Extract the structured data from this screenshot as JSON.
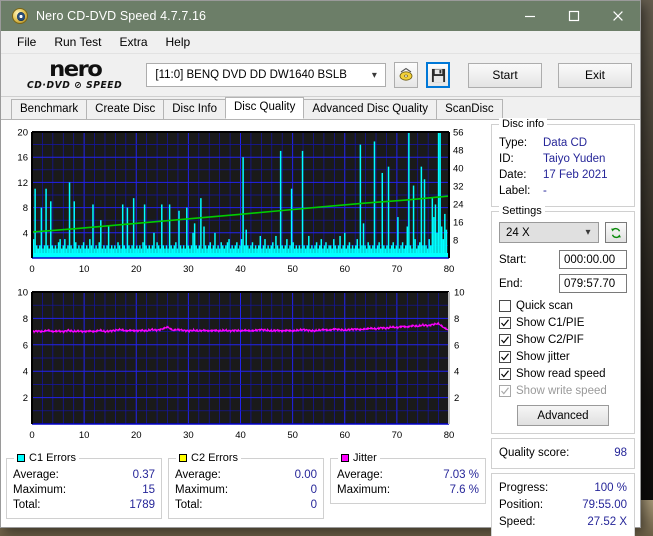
{
  "window": {
    "title": "Nero CD-DVD Speed 4.7.7.16",
    "icon": "nero-app-icon",
    "minimize_icon": "minimize-icon",
    "maximize_icon": "maximize-icon",
    "close_icon": "close-icon"
  },
  "menu": {
    "items": [
      "File",
      "Run Test",
      "Extra",
      "Help"
    ]
  },
  "toolbar": {
    "logo_main": "nero",
    "logo_sub": "CD·DVD ⊘ SPEED",
    "drive": "[11:0]   BENQ DVD DD DW1640 BSLB",
    "drive_chevron": "chevron-down-icon",
    "eject_icon": "eject-disc-icon",
    "save_icon": "save-floppy-icon",
    "start_label": "Start",
    "exit_label": "Exit"
  },
  "tabs": [
    {
      "label": "Benchmark",
      "active": false
    },
    {
      "label": "Create Disc",
      "active": false
    },
    {
      "label": "Disc Info",
      "active": false
    },
    {
      "label": "Disc Quality",
      "active": true
    },
    {
      "label": "Advanced Disc Quality",
      "active": false
    },
    {
      "label": "ScanDisc",
      "active": false
    }
  ],
  "disc_info": {
    "title": "Disc info",
    "rows": [
      {
        "key": "Type:",
        "value": "Data CD"
      },
      {
        "key": "ID:",
        "value": "Taiyo Yuden"
      },
      {
        "key": "Date:",
        "value": "17 Feb 2021"
      },
      {
        "key": "Label:",
        "value": "-"
      }
    ]
  },
  "settings": {
    "title": "Settings",
    "speed": "24 X",
    "speed_chevron": "chevron-down-icon",
    "refresh_icon": "refresh-icon",
    "start_label": "Start:",
    "start_value": "000:00.00",
    "end_label": "End:",
    "end_value": "079:57.70",
    "checkboxes": [
      {
        "label": "Quick scan",
        "checked": false,
        "disabled": false
      },
      {
        "label": "Show C1/PIE",
        "checked": true,
        "disabled": false
      },
      {
        "label": "Show C2/PIF",
        "checked": true,
        "disabled": false
      },
      {
        "label": "Show jitter",
        "checked": true,
        "disabled": false
      },
      {
        "label": "Show read speed",
        "checked": true,
        "disabled": false
      },
      {
        "label": "Show write speed",
        "checked": true,
        "disabled": true
      }
    ],
    "advanced_label": "Advanced"
  },
  "quality": {
    "label": "Quality score:",
    "value": "98"
  },
  "progress": {
    "rows": [
      {
        "key": "Progress:",
        "value": "100 %"
      },
      {
        "key": "Position:",
        "value": "79:55.00"
      },
      {
        "key": "Speed:",
        "value": "27.52 X"
      }
    ]
  },
  "stats": {
    "c1": {
      "title": "C1 Errors",
      "color": "#00ffff",
      "rows": [
        {
          "key": "Average:",
          "value": "0.37"
        },
        {
          "key": "Maximum:",
          "value": "15"
        },
        {
          "key": "Total:",
          "value": "1789"
        }
      ]
    },
    "c2": {
      "title": "C2 Errors",
      "color": "#ffff00",
      "rows": [
        {
          "key": "Average:",
          "value": "0.00"
        },
        {
          "key": "Maximum:",
          "value": "0"
        },
        {
          "key": "Total:",
          "value": "0"
        }
      ]
    },
    "jitter": {
      "title": "Jitter",
      "color": "#ff00ff",
      "rows": [
        {
          "key": "Average:",
          "value": "7.03 %"
        },
        {
          "key": "Maximum:",
          "value": "7.6 %"
        }
      ]
    }
  },
  "chart_data": [
    {
      "type": "bar",
      "name": "c1-errors-chart",
      "title": "",
      "xlabel": "",
      "ylabel": "C1 errors",
      "y2label": "Read speed (X)",
      "xlim": [
        0,
        80
      ],
      "ylim": [
        0,
        20
      ],
      "y2lim": [
        0,
        56
      ],
      "xticks": [
        0,
        10,
        20,
        30,
        40,
        50,
        60,
        70,
        80
      ],
      "yticks": [
        4,
        8,
        12,
        16,
        20
      ],
      "y2ticks": [
        8,
        16,
        24,
        32,
        40,
        48,
        56
      ],
      "grid": true,
      "background": "#1a1a1a",
      "grid_color": "#0000cc",
      "bar_color": "#00ffff",
      "line_color": "#00cc00",
      "x": [
        0.3,
        0.6,
        0.9,
        1.2,
        1.5,
        1.8,
        2.1,
        2.4,
        2.7,
        3.0,
        3.3,
        3.6,
        3.9,
        4.2,
        4.5,
        4.8,
        5.1,
        5.4,
        5.7,
        6.0,
        6.3,
        6.6,
        6.9,
        7.2,
        7.5,
        7.8,
        8.1,
        8.4,
        8.7,
        9.0,
        9.3,
        9.6,
        9.9,
        10.2,
        10.5,
        10.8,
        11.1,
        11.4,
        11.7,
        12.0,
        12.3,
        12.6,
        12.9,
        13.2,
        13.5,
        13.8,
        14.1,
        14.4,
        14.7,
        15.0,
        15.3,
        15.6,
        15.9,
        16.2,
        16.5,
        16.8,
        17.1,
        17.4,
        17.7,
        18.0,
        18.3,
        18.6,
        18.9,
        19.2,
        19.5,
        19.8,
        20.1,
        20.4,
        20.7,
        21.0,
        21.3,
        21.6,
        21.9,
        22.2,
        22.5,
        22.8,
        23.1,
        23.4,
        23.7,
        24.0,
        24.3,
        24.6,
        24.9,
        25.2,
        25.5,
        25.8,
        26.1,
        26.4,
        26.7,
        27.0,
        27.3,
        27.6,
        27.9,
        28.2,
        28.5,
        28.8,
        29.1,
        29.4,
        29.7,
        30.0,
        30.3,
        30.6,
        30.9,
        31.2,
        31.5,
        31.8,
        32.1,
        32.4,
        32.7,
        33.0,
        33.3,
        33.6,
        33.9,
        34.2,
        34.5,
        34.8,
        35.1,
        35.4,
        35.7,
        36.0,
        36.3,
        36.6,
        36.9,
        37.2,
        37.5,
        37.8,
        38.1,
        38.4,
        38.7,
        39.0,
        39.3,
        39.6,
        39.9,
        40.2,
        40.5,
        40.8,
        41.1,
        41.4,
        41.7,
        42.0,
        42.3,
        42.6,
        42.9,
        43.2,
        43.5,
        43.8,
        44.1,
        44.4,
        44.7,
        45.0,
        45.3,
        45.6,
        45.9,
        46.2,
        46.5,
        46.8,
        47.1,
        47.4,
        47.7,
        48.0,
        48.3,
        48.6,
        48.9,
        49.2,
        49.5,
        49.8,
        50.1,
        50.4,
        50.7,
        51.0,
        51.3,
        51.6,
        51.9,
        52.2,
        52.5,
        52.8,
        53.1,
        53.4,
        53.7,
        54.0,
        54.3,
        54.6,
        54.9,
        55.2,
        55.5,
        55.8,
        56.1,
        56.4,
        56.7,
        57.0,
        57.3,
        57.6,
        57.9,
        58.2,
        58.5,
        58.8,
        59.1,
        59.4,
        59.7,
        60.0,
        60.3,
        60.6,
        60.9,
        61.2,
        61.5,
        61.8,
        62.1,
        62.4,
        62.7,
        63.0,
        63.3,
        63.6,
        63.9,
        64.2,
        64.5,
        64.8,
        65.1,
        65.4,
        65.7,
        66.0,
        66.3,
        66.6,
        66.9,
        67.2,
        67.5,
        67.8,
        68.1,
        68.4,
        68.7,
        69.0,
        69.3,
        69.6,
        69.9,
        70.2,
        70.5,
        70.8,
        71.1,
        71.4,
        71.7,
        72.0,
        72.3,
        72.6,
        72.9,
        73.2,
        73.5,
        73.8,
        74.1,
        74.4,
        74.7,
        75.0,
        75.3,
        75.6,
        75.9,
        76.2,
        76.5,
        76.8,
        77.1,
        77.4,
        77.7,
        78.0,
        78.3,
        78.6,
        78.9,
        79.2,
        79.5
      ],
      "values": [
        3.0,
        11.0,
        2.0,
        1.5,
        2.0,
        8.0,
        1.5,
        2.0,
        11.0,
        2.0,
        1.5,
        9.0,
        2.0,
        1.5,
        2.0,
        1.5,
        2.5,
        3.0,
        1.5,
        2.0,
        3.0,
        1.5,
        2.0,
        12.0,
        2.0,
        1.5,
        9.0,
        2.5,
        1.5,
        2.0,
        1.5,
        2.0,
        2.5,
        1.5,
        2.0,
        1.5,
        3.0,
        2.0,
        8.5,
        1.5,
        2.0,
        1.5,
        2.5,
        6.0,
        1.5,
        2.0,
        1.5,
        2.0,
        5.0,
        1.5,
        2.0,
        1.5,
        2.0,
        1.5,
        2.5,
        2.0,
        1.5,
        8.5,
        2.0,
        1.5,
        8.0,
        2.0,
        1.5,
        2.0,
        9.5,
        1.5,
        2.0,
        1.5,
        2.0,
        1.5,
        2.5,
        8.5,
        2.0,
        1.5,
        2.0,
        1.5,
        2.0,
        4.0,
        1.5,
        2.5,
        2.0,
        1.5,
        8.5,
        2.0,
        1.5,
        2.0,
        1.5,
        8.5,
        2.0,
        1.5,
        2.0,
        2.5,
        1.5,
        7.5,
        2.0,
        1.5,
        2.0,
        1.5,
        8.0,
        2.0,
        1.5,
        2.0,
        4.0,
        5.5,
        2.0,
        1.5,
        2.0,
        9.5,
        1.5,
        5.0,
        2.0,
        1.5,
        2.0,
        2.5,
        1.5,
        2.0,
        4.0,
        1.5,
        2.0,
        1.5,
        2.5,
        2.0,
        1.5,
        2.0,
        2.5,
        3.0,
        1.5,
        2.0,
        1.5,
        2.0,
        2.5,
        1.5,
        2.0,
        3.0,
        16.0,
        2.0,
        4.5,
        2.0,
        1.5,
        2.0,
        2.5,
        1.5,
        2.0,
        1.5,
        2.0,
        3.5,
        1.5,
        2.0,
        3.0,
        1.5,
        2.0,
        1.5,
        2.0,
        2.5,
        1.5,
        3.5,
        2.0,
        1.5,
        17.0,
        2.0,
        1.5,
        2.0,
        3.0,
        1.5,
        2.0,
        11.0,
        2.5,
        1.5,
        2.0,
        1.5,
        2.0,
        1.5,
        17.0,
        2.0,
        1.5,
        2.0,
        3.5,
        1.5,
        2.0,
        1.5,
        2.0,
        2.5,
        1.5,
        2.0,
        3.0,
        1.5,
        2.0,
        2.5,
        1.5,
        2.0,
        2.0,
        1.5,
        3.0,
        2.0,
        1.5,
        2.0,
        3.5,
        1.5,
        2.0,
        4.0,
        1.5,
        2.0,
        2.5,
        1.5,
        2.0,
        1.5,
        2.0,
        3.0,
        1.5,
        18.0,
        2.0,
        5.5,
        2.0,
        1.5,
        2.5,
        2.0,
        1.5,
        2.0,
        18.5,
        1.5,
        2.0,
        2.5,
        1.5,
        13.5,
        2.0,
        1.5,
        2.0,
        14.5,
        1.5,
        2.0,
        2.5,
        1.5,
        2.0,
        6.5,
        1.5,
        2.0,
        2.5,
        1.5,
        2.0,
        5.0,
        21.5,
        2.0,
        1.5,
        11.5,
        3.0,
        1.5,
        2.0,
        2.5,
        14.5,
        2.0,
        12.5,
        2.0,
        1.5,
        3.0,
        2.0,
        9.5,
        6.5,
        8.5,
        4.0,
        41.0,
        24.0,
        5.0,
        3.0,
        7.0,
        4.5,
        2.0,
        3.0
      ],
      "speed_line": {
        "name": "Read speed",
        "x": [
          0,
          8,
          16,
          24,
          32,
          40,
          48,
          56,
          64,
          72,
          80
        ],
        "y": [
          11.5,
          13.0,
          14.6,
          16.2,
          17.8,
          19.4,
          21.1,
          22.8,
          24.4,
          25.8,
          27.5
        ]
      }
    },
    {
      "type": "line",
      "name": "jitter-chart",
      "title": "",
      "xlabel": "",
      "ylabel": "Jitter %",
      "xlim": [
        0,
        80
      ],
      "ylim": [
        0,
        10
      ],
      "xticks": [
        0,
        10,
        20,
        30,
        40,
        50,
        60,
        70,
        80
      ],
      "yticks": [
        2,
        4,
        6,
        8,
        10
      ],
      "y2ticks": [
        2,
        4,
        6,
        8,
        10
      ],
      "grid": true,
      "background": "#1a1a1a",
      "grid_color": "#0000cc",
      "line_color": "#ff00ff",
      "series": [
        {
          "name": "Jitter",
          "x": [
            0,
            1,
            2,
            3,
            4,
            5,
            6,
            7,
            8,
            9,
            10,
            11,
            12,
            13,
            14,
            15,
            16,
            17,
            18,
            19,
            20,
            21,
            22,
            23,
            24,
            25,
            26,
            27,
            28,
            29,
            30,
            31,
            32,
            33,
            34,
            35,
            36,
            37,
            38,
            39,
            40,
            41,
            42,
            43,
            44,
            45,
            46,
            47,
            48,
            49,
            50,
            51,
            52,
            53,
            54,
            55,
            56,
            57,
            58,
            59,
            60,
            61,
            62,
            63,
            64,
            65,
            66,
            67,
            68,
            69,
            70,
            71,
            72,
            73,
            74,
            75,
            76,
            77,
            78,
            79,
            80
          ],
          "values": [
            7.0,
            7.05,
            7.0,
            7.1,
            7.0,
            7.05,
            7.0,
            7.1,
            7.0,
            7.05,
            7.0,
            7.05,
            7.0,
            7.1,
            7.0,
            7.05,
            7.1,
            7.15,
            7.05,
            7.1,
            7.05,
            7.1,
            7.05,
            7.15,
            7.1,
            7.2,
            7.35,
            7.1,
            7.15,
            7.1,
            7.05,
            7.1,
            7.05,
            7.1,
            7.05,
            7.1,
            7.05,
            7.1,
            7.05,
            7.1,
            7.05,
            7.1,
            7.05,
            7.1,
            7.15,
            7.1,
            7.05,
            7.1,
            7.05,
            7.1,
            7.05,
            7.1,
            7.15,
            7.1,
            7.05,
            7.1,
            7.15,
            7.1,
            7.2,
            7.15,
            7.1,
            7.15,
            7.2,
            7.15,
            7.2,
            7.25,
            7.2,
            7.3,
            7.25,
            7.35,
            7.3,
            7.4,
            7.35,
            7.45,
            7.4,
            7.5,
            7.45,
            7.55,
            7.6,
            7.3,
            7.1
          ]
        }
      ]
    }
  ]
}
